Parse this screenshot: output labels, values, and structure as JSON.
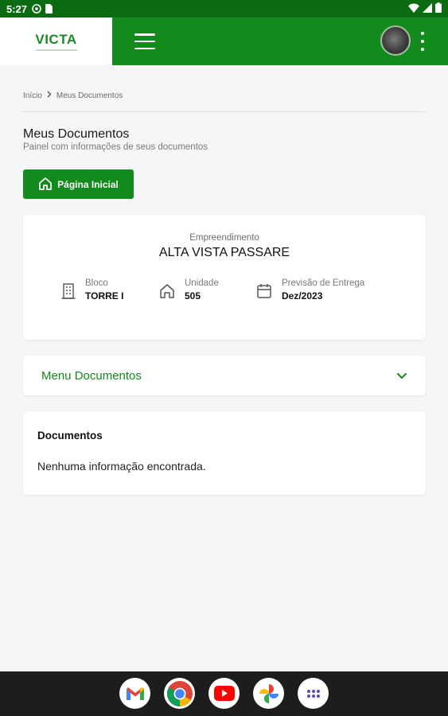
{
  "status_bar": {
    "time": "5:27"
  },
  "app_bar": {
    "logo_text": "VICTA"
  },
  "breadcrumb": {
    "home": "Início",
    "current": "Meus Documentos"
  },
  "page": {
    "title": "Meus Documentos",
    "subtitle": "Painel com informações de seus documentos"
  },
  "home_button": {
    "label": "Página Inicial"
  },
  "empreendimento": {
    "label": "Empreendimento",
    "value": "ALTA VISTA PASSARE",
    "bloco": {
      "label": "Bloco",
      "value": "TORRE I"
    },
    "unidade": {
      "label": "Unidade",
      "value": "505"
    },
    "entrega": {
      "label": "Previsão de Entrega",
      "value": "Dez/2023"
    }
  },
  "menu_documentos": {
    "label": "Menu Documentos"
  },
  "documentos": {
    "title": "Documentos",
    "empty_message": "Nenhuma informação encontrada."
  },
  "dock": {
    "apps": [
      "gmail-icon",
      "chrome-icon",
      "youtube-icon",
      "photos-icon",
      "app-drawer-icon"
    ]
  },
  "colors": {
    "primary": "#128a1c",
    "status_bar": "#0b6b12",
    "background": "#f5f6f7",
    "nav_bar": "#1d1d1d"
  }
}
